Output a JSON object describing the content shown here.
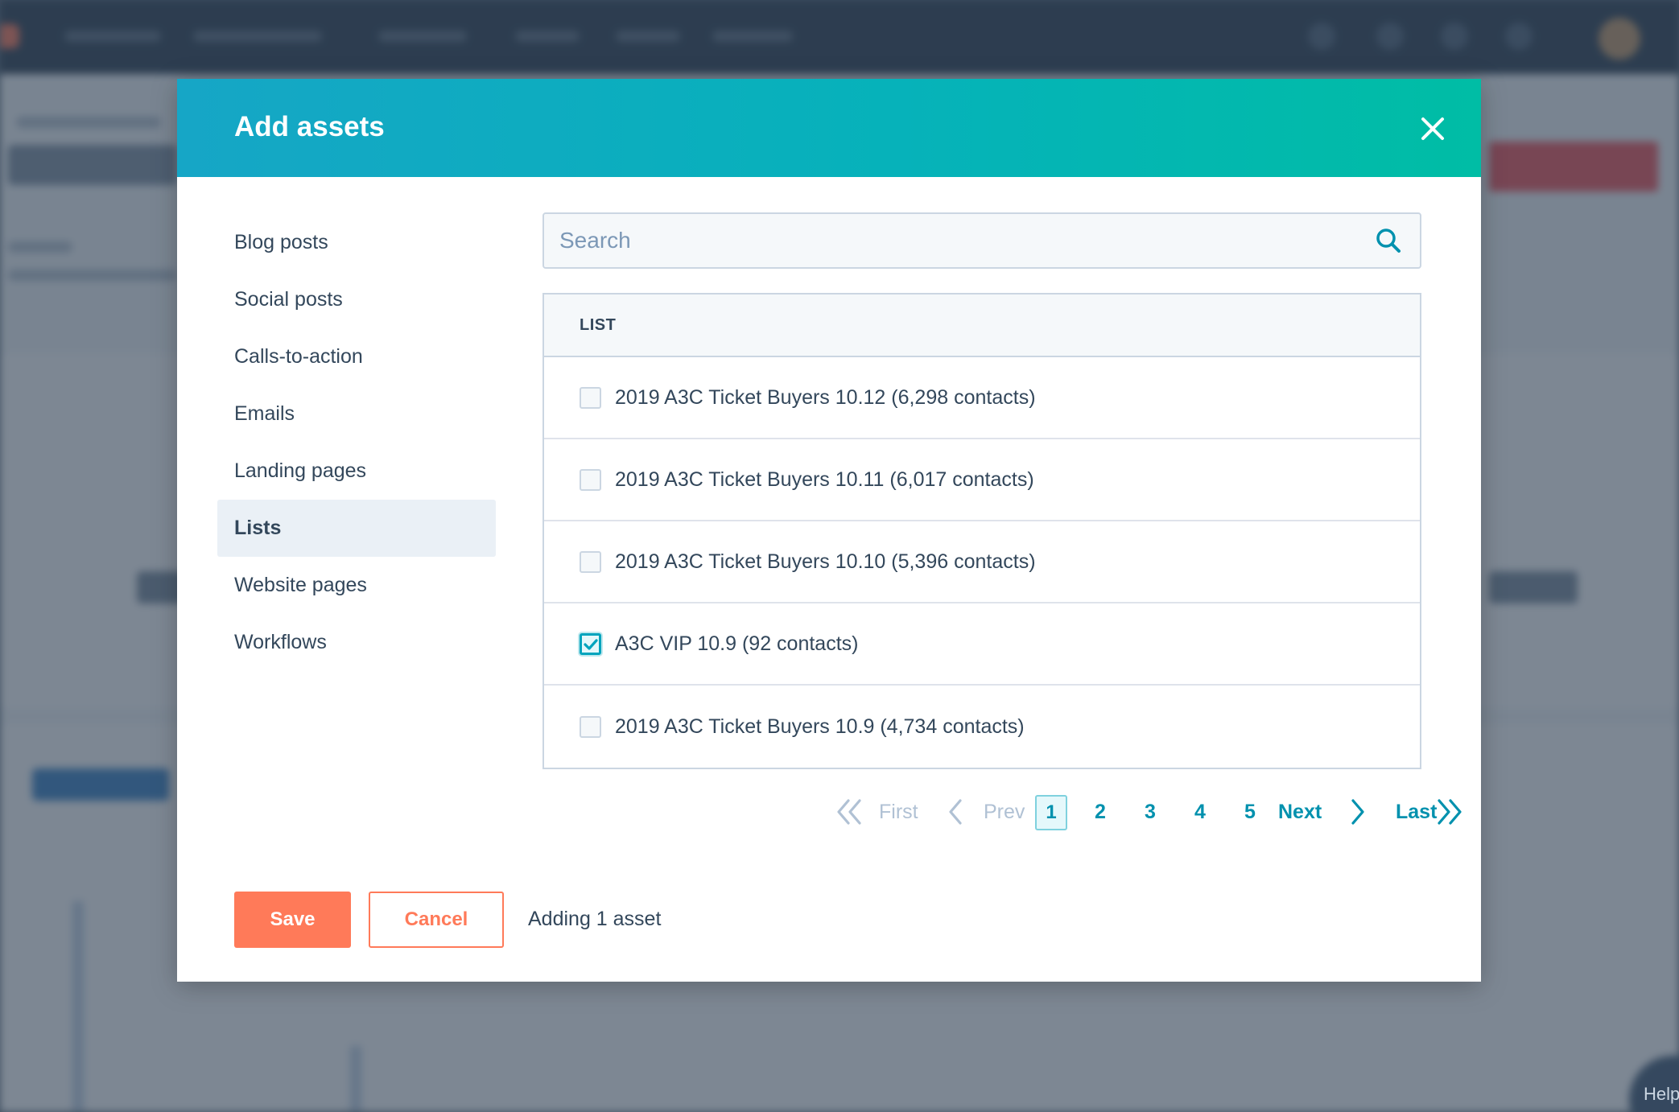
{
  "modal": {
    "title": "Add assets"
  },
  "sidebar": {
    "items": [
      {
        "label": "Blog posts",
        "active": false
      },
      {
        "label": "Social posts",
        "active": false
      },
      {
        "label": "Calls-to-action",
        "active": false
      },
      {
        "label": "Emails",
        "active": false
      },
      {
        "label": "Landing pages",
        "active": false
      },
      {
        "label": "Lists",
        "active": true
      },
      {
        "label": "Website pages",
        "active": false
      },
      {
        "label": "Workflows",
        "active": false
      }
    ]
  },
  "search": {
    "placeholder": "Search",
    "value": ""
  },
  "table": {
    "header": "LIST",
    "rows": [
      {
        "label": "2019 A3C Ticket Buyers 10.12 (6,298 contacts)",
        "checked": false
      },
      {
        "label": "2019 A3C Ticket Buyers 10.11 (6,017 contacts)",
        "checked": false
      },
      {
        "label": "2019 A3C Ticket Buyers 10.10 (5,396 contacts)",
        "checked": false
      },
      {
        "label": "A3C VIP 10.9 (92 contacts)",
        "checked": true
      },
      {
        "label": "2019 A3C Ticket Buyers 10.9 (4,734 contacts)",
        "checked": false
      }
    ]
  },
  "pagination": {
    "first_label": "First",
    "prev_label": "Prev",
    "pages": [
      "1",
      "2",
      "3",
      "4",
      "5"
    ],
    "current": "1",
    "next_label": "Next",
    "last_label": "Last"
  },
  "footer": {
    "save_label": "Save",
    "cancel_label": "Cancel",
    "status": "Adding 1 asset"
  },
  "background": {
    "help_label": "Help"
  },
  "colors": {
    "accent_teal": "#00a4bd",
    "primary_orange": "#ff7a59",
    "text_dark": "#33475b",
    "link_teal": "#0091ae"
  },
  "icons": {
    "close": "close-icon",
    "search": "search-icon",
    "checkbox_check": "check-icon",
    "first": "double-chevron-left-icon",
    "prev": "chevron-left-icon",
    "next": "chevron-right-icon",
    "last": "double-chevron-right-icon"
  }
}
